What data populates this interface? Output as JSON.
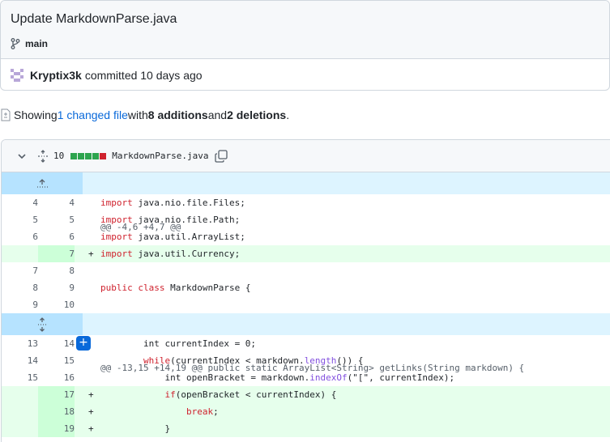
{
  "commit": {
    "title": "Update MarkdownParse.java",
    "branch": "main",
    "author": "Kryptix3k",
    "meta": "committed 10 days ago"
  },
  "summary": {
    "prefix": "Showing ",
    "changed_link": "1 changed file",
    "mid1": " with ",
    "additions": "8 additions",
    "mid2": " and ",
    "deletions": "2 deletions",
    "suffix": "."
  },
  "file": {
    "change_count": "10",
    "diffstat": [
      "add",
      "add",
      "add",
      "add",
      "del"
    ],
    "name": "MarkdownParse.java"
  },
  "colors": {
    "add": "#2da44e",
    "del": "#cf222e",
    "link": "#0969da"
  },
  "diff": {
    "hunk1": "@@ -4,6 +4,7 @@",
    "hunk2": "@@ -13,15 +14,19 @@ public static ArrayList<String> getLinks(String markdown) {",
    "lines": [
      {
        "o": "4",
        "n": "4",
        "s": "",
        "t": "import",
        "r": " java.nio.file.Files;"
      },
      {
        "o": "5",
        "n": "5",
        "s": "",
        "t": "import",
        "r": " java.nio.file.Path;"
      },
      {
        "o": "6",
        "n": "6",
        "s": "",
        "t": "import",
        "r": " java.util.ArrayList;"
      },
      {
        "o": "",
        "n": "7",
        "s": "+",
        "t": "import",
        "r": " java.util.Currency;"
      },
      {
        "o": "7",
        "n": "8",
        "s": "",
        "t": "",
        "r": ""
      },
      {
        "o": "8",
        "n": "9",
        "s": "",
        "t": "public class",
        "r": " MarkdownParse {"
      },
      {
        "o": "9",
        "n": "10",
        "s": "",
        "t": "",
        "r": ""
      }
    ],
    "lines2": [
      {
        "o": "13",
        "n": "14",
        "s": "",
        "code": "        int currentIndex = 0;"
      },
      {
        "o": "14",
        "n": "15",
        "s": "",
        "code": "        while(currentIndex < markdown.length()) {"
      },
      {
        "o": "15",
        "n": "16",
        "s": "",
        "code": "            int openBracket = markdown.indexOf(\"[\", currentIndex);"
      },
      {
        "o": "",
        "n": "17",
        "s": "+",
        "code": "            if(openBracket < currentIndex) {"
      },
      {
        "o": "",
        "n": "18",
        "s": "+",
        "code": "                break;"
      },
      {
        "o": "",
        "n": "19",
        "s": "+",
        "code": "            }"
      }
    ]
  }
}
